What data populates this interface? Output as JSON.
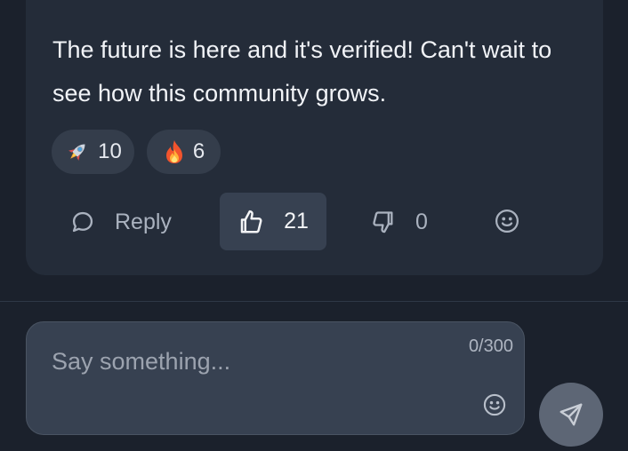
{
  "comment": {
    "text": "The future is here and it's verified! Can't wait to see how this community grows.",
    "reactions": [
      {
        "emoji": "rocket-icon",
        "count": "10"
      },
      {
        "emoji": "fire-icon",
        "count": "6"
      }
    ],
    "actions": {
      "reply_label": "Reply",
      "like_count": "21",
      "dislike_count": "0"
    }
  },
  "composer": {
    "placeholder": "Say something...",
    "counter": "0/300"
  },
  "colors": {
    "background": "#1b212c",
    "card": "#242c39",
    "chip": "#343d4b",
    "active_button": "#374151",
    "send_button": "#5d6675"
  }
}
